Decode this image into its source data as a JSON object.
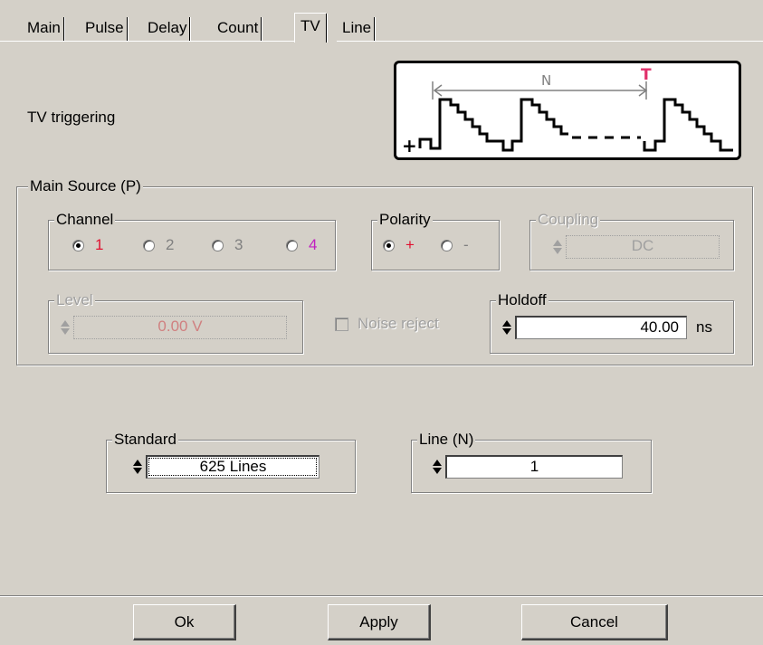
{
  "tabs": [
    "Main",
    "Pulse",
    "Delay",
    "Count",
    "TV",
    "Line"
  ],
  "active_tab": "TV",
  "header": {
    "label": "TV triggering",
    "diagram": {
      "span_label": "N",
      "trigger_mark": "T",
      "polarity_mark": "+",
      "trigger_color": "#e0306a"
    }
  },
  "main_source": {
    "title": "Main Source (P)",
    "channel": {
      "title": "Channel",
      "options": [
        "1",
        "2",
        "3",
        "4"
      ],
      "selected": "1",
      "colors": [
        "#e01030",
        "#808080",
        "#808080",
        "#c020c0"
      ]
    },
    "polarity": {
      "title": "Polarity",
      "options": [
        "+",
        "-"
      ],
      "selected": "+"
    },
    "coupling": {
      "title": "Coupling",
      "value": "DC"
    },
    "level": {
      "title": "Level",
      "value": "0.00 V"
    },
    "noise_reject": {
      "label": "Noise reject",
      "checked": false
    },
    "holdoff": {
      "title": "Holdoff",
      "value": "40.00",
      "unit": "ns"
    }
  },
  "standard": {
    "title": "Standard",
    "value": "625 Lines"
  },
  "line_n": {
    "title": "Line (N)",
    "value": "1"
  },
  "buttons": {
    "ok": "Ok",
    "apply": "Apply",
    "cancel": "Cancel"
  }
}
